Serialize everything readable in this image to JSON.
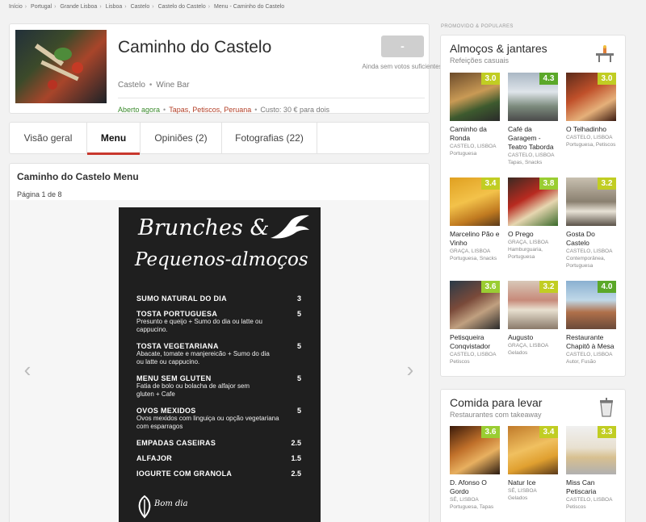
{
  "breadcrumb": [
    "Início",
    "Portugal",
    "Grande Lisboa",
    "Lisboa",
    "Castelo",
    "Castelo do Castelo",
    "Menu - Caminho do Castelo"
  ],
  "restaurant": {
    "name": "Caminho do Castelo",
    "area": "Castelo",
    "type": "Wine Bar",
    "score": "-",
    "votes_text": "Ainda sem votos suficientes",
    "status_open": "Aberto agora",
    "cuisine": "Tapas, Petiscos, Peruana",
    "cost": "Custo: 30 € para dois"
  },
  "tabs": [
    "Visão geral",
    "Menu",
    "Opiniões (2)",
    "Fotografias (22)"
  ],
  "menu": {
    "title": "Caminho do Castelo Menu",
    "page_label": "Página 1 de 8",
    "image": {
      "heading1": "Brunches &",
      "heading2": "Pequenos-almoços",
      "items": [
        {
          "name": "SUMO NATURAL DO DIA",
          "price": "3",
          "desc": ""
        },
        {
          "name": "TOSTA  PORTUGUESA",
          "price": "5",
          "desc": "Presunto e queijo  + Sumo do dia ou latte ou cappucino."
        },
        {
          "name": "TOSTA VEGETARIANA",
          "price": "5",
          "desc": "Abacate, tomate e manjereicão + Sumo do dia ou latte ou cappucino."
        },
        {
          "name": "MENU SEM GLUTEN",
          "price": "5",
          "desc": "Fatia de bolo ou bolacha de alfajor sem gluten + Cafe"
        },
        {
          "name": "OVOS MEXIDOS",
          "price": "5",
          "desc": "Ovos mexidos com linguiça ou opção vegetariana com esparragos"
        },
        {
          "name": "EMPADAS CASEIRAS",
          "price": "2.5",
          "desc": ""
        },
        {
          "name": "ALFAJOR",
          "price": "1.5",
          "desc": ""
        },
        {
          "name": "IOGURTE COM GRANOLA",
          "price": "2.5",
          "desc": ""
        }
      ],
      "logo_text": "Bom dia"
    }
  },
  "sidebar": {
    "promo_label": "PROMOVIDO & POPULARES",
    "sections": [
      {
        "title": "Almoços & jantares",
        "subtitle": "Refeições casuais",
        "items": [
          {
            "name": "Caminho da Ronda",
            "location": "CASTELO, LISBOA",
            "tags": "Portuguesa",
            "rating": "3.0",
            "color": "#c1cd23"
          },
          {
            "name": "Café da Garagem - Teatro Taborda",
            "location": "CASTELO, LISBOA",
            "tags": "Tapas, Snacks",
            "rating": "4.3",
            "color": "#5ba829"
          },
          {
            "name": "O Telhadinho",
            "location": "CASTELO, LISBOA",
            "tags": "Portuguesa, Petiscos",
            "rating": "3.0",
            "color": "#c1cd23"
          },
          {
            "name": "Marcelino Pão e Vinho",
            "location": "GRAÇA, LISBOA",
            "tags": "Portuguesa, Snacks",
            "rating": "3.4",
            "color": "#c1cd23"
          },
          {
            "name": "O Prego",
            "location": "GRAÇA, LISBOA",
            "tags": "Hamburguaria, Portuguesa",
            "rating": "3.8",
            "color": "#9acd32"
          },
          {
            "name": "Gosta Do Castelo",
            "location": "CASTELO, LISBOA",
            "tags": "Contemporânea, Portuguesa",
            "rating": "3.2",
            "color": "#c1cd23"
          },
          {
            "name": "Petisqueira Conqvistador",
            "location": "CASTELO, LISBOA",
            "tags": "Petiscos",
            "rating": "3.6",
            "color": "#9acd32"
          },
          {
            "name": "Augusto",
            "location": "GRAÇA, LISBOA",
            "tags": "Gelados",
            "rating": "3.2",
            "color": "#c1cd23"
          },
          {
            "name": "Restaurante Chapitô à Mesa",
            "location": "CASTELO, LISBOA",
            "tags": "Autor, Fusão",
            "rating": "4.0",
            "color": "#5ba829"
          }
        ]
      },
      {
        "title": "Comida para levar",
        "subtitle": "Restaurantes com takeaway",
        "items": [
          {
            "name": "D. Afonso O Gordo",
            "location": "SÉ, LISBOA",
            "tags": "Portuguesa, Tapas",
            "rating": "3.6",
            "color": "#9acd32"
          },
          {
            "name": "Natur Ice",
            "location": "SÉ, LISBOA",
            "tags": "Gelados",
            "rating": "3.4",
            "color": "#c1cd23"
          },
          {
            "name": "Miss Can Petiscaria",
            "location": "CASTELO, LISBOA",
            "tags": "Petiscos",
            "rating": "3.3",
            "color": "#c1cd23"
          }
        ]
      }
    ]
  }
}
